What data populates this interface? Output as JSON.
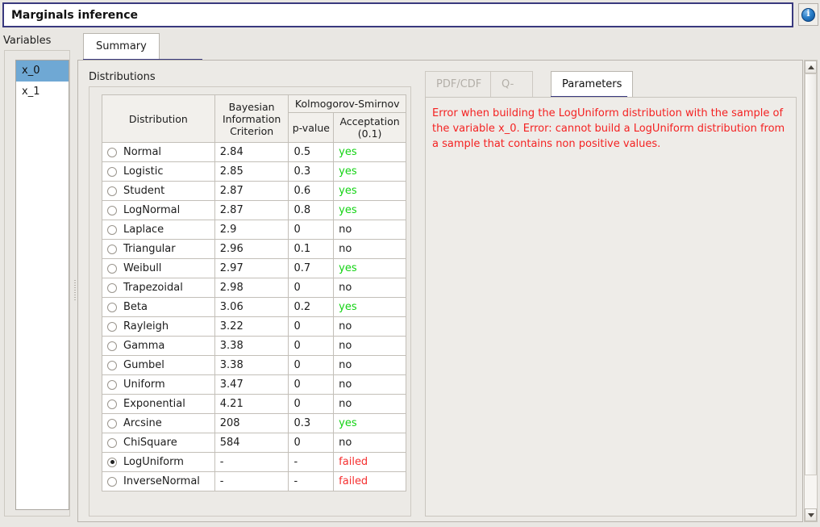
{
  "window": {
    "title": "Marginals inference",
    "info_icon": "info-icon"
  },
  "sidebar": {
    "label": "Variables",
    "items": [
      {
        "label": "x_0",
        "selected": true
      },
      {
        "label": "x_1",
        "selected": false
      }
    ]
  },
  "tabs": {
    "main": [
      {
        "label": "Summary",
        "active": true
      }
    ]
  },
  "main": {
    "group_label": "Distributions",
    "table": {
      "headers": {
        "distribution": "Distribution",
        "bic": "Bayesian Information Criterion",
        "ks": "Kolmogorov-Smirnov",
        "pvalue": "p-value",
        "acceptation": "Acceptation (0.1)"
      },
      "rows": [
        {
          "name": "Normal",
          "bic": "2.84",
          "pvalue": "0.5",
          "acceptation": "yes",
          "status": "yes",
          "selected": false
        },
        {
          "name": "Logistic",
          "bic": "2.85",
          "pvalue": "0.3",
          "acceptation": "yes",
          "status": "yes",
          "selected": false
        },
        {
          "name": "Student",
          "bic": "2.87",
          "pvalue": "0.6",
          "acceptation": "yes",
          "status": "yes",
          "selected": false
        },
        {
          "name": "LogNormal",
          "bic": "2.87",
          "pvalue": "0.8",
          "acceptation": "yes",
          "status": "yes",
          "selected": false
        },
        {
          "name": "Laplace",
          "bic": "2.9",
          "pvalue": "0",
          "acceptation": "no",
          "status": "no",
          "selected": false
        },
        {
          "name": "Triangular",
          "bic": "2.96",
          "pvalue": "0.1",
          "acceptation": "no",
          "status": "no",
          "selected": false
        },
        {
          "name": "Weibull",
          "bic": "2.97",
          "pvalue": "0.7",
          "acceptation": "yes",
          "status": "yes",
          "selected": false
        },
        {
          "name": "Trapezoidal",
          "bic": "2.98",
          "pvalue": "0",
          "acceptation": "no",
          "status": "no",
          "selected": false
        },
        {
          "name": "Beta",
          "bic": "3.06",
          "pvalue": "0.2",
          "acceptation": "yes",
          "status": "yes",
          "selected": false
        },
        {
          "name": "Rayleigh",
          "bic": "3.22",
          "pvalue": "0",
          "acceptation": "no",
          "status": "no",
          "selected": false
        },
        {
          "name": "Gamma",
          "bic": "3.38",
          "pvalue": "0",
          "acceptation": "no",
          "status": "no",
          "selected": false
        },
        {
          "name": "Gumbel",
          "bic": "3.38",
          "pvalue": "0",
          "acceptation": "no",
          "status": "no",
          "selected": false
        },
        {
          "name": "Uniform",
          "bic": "3.47",
          "pvalue": "0",
          "acceptation": "no",
          "status": "no",
          "selected": false
        },
        {
          "name": "Exponential",
          "bic": "4.21",
          "pvalue": "0",
          "acceptation": "no",
          "status": "no",
          "selected": false
        },
        {
          "name": "Arcsine",
          "bic": "208",
          "pvalue": "0.3",
          "acceptation": "yes",
          "status": "yes",
          "selected": false
        },
        {
          "name": "ChiSquare",
          "bic": "584",
          "pvalue": "0",
          "acceptation": "no",
          "status": "no",
          "selected": false
        },
        {
          "name": "LogUniform",
          "bic": "-",
          "pvalue": "-",
          "acceptation": "failed",
          "status": "failed",
          "selected": true
        },
        {
          "name": "InverseNormal",
          "bic": "-",
          "pvalue": "-",
          "acceptation": "failed",
          "status": "failed",
          "selected": false
        }
      ]
    }
  },
  "right_panel": {
    "tabs": [
      {
        "label": "PDF/CDF",
        "active": false,
        "enabled": false
      },
      {
        "label": "Q-Q Plot",
        "active": false,
        "enabled": false
      },
      {
        "label": "Parameters",
        "active": true,
        "enabled": true
      }
    ],
    "error_message": "Error when building the LogUniform distribution with the sample of the variable x_0. Error: cannot build a LogUniform distribution from a sample that contains non positive values."
  },
  "colors": {
    "accent": "#39397e",
    "selection": "#6fa8d4",
    "success": "#12d312",
    "error": "#f42222",
    "failed": "#f53030"
  }
}
